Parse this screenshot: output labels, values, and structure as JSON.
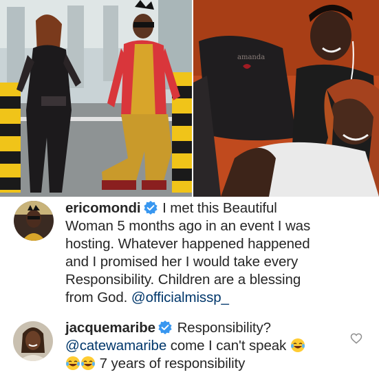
{
  "post": {
    "left_photo_alt": "Couple posing in sparkly outfits outdoors",
    "right_photo_alt": "Couple selfie on a sofa"
  },
  "comments": [
    {
      "username": "ericomondi",
      "verified": true,
      "avatar_icon": "user-avatar",
      "lines": [
        "I met this Beautiful",
        "Woman  5 months ago in an event I was",
        "hosting. Whatever happened happened",
        "and I promised her I would take every",
        "Responsibility. Children are a blessing",
        "from God."
      ],
      "mention": "@officialmissp_"
    },
    {
      "username": "jacquemaribe",
      "verified": true,
      "avatar_icon": "user-avatar",
      "text_1": "Responsibility?",
      "mention": "@catewamaribe",
      "text_2": "come I can't speak",
      "text_3": "7 years of responsibility",
      "emoji_icon": "tears-of-joy-emoji",
      "like_icon": "heart-outline-icon"
    }
  ],
  "colors": {
    "verified_blue": "#3897f0",
    "mention_blue": "#00376b",
    "text": "#262626"
  }
}
